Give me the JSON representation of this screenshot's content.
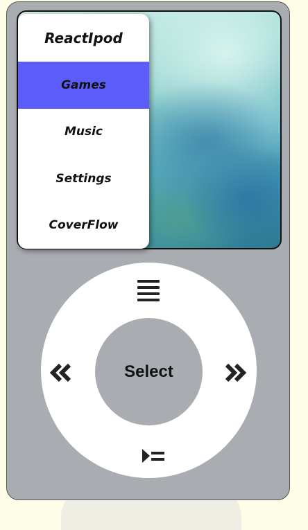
{
  "menu": {
    "title": "ReactIpod",
    "items": [
      {
        "label": "Games",
        "active": true
      },
      {
        "label": "Music",
        "active": false
      },
      {
        "label": "Settings",
        "active": false
      },
      {
        "label": "CoverFlow",
        "active": false
      }
    ]
  },
  "wheel": {
    "select_label": "Select",
    "icons": {
      "top": "menu-icon",
      "left": "rewind-icon",
      "right": "fast-forward-icon",
      "bottom": "play-pause-icon"
    }
  },
  "colors": {
    "body": "#a9acb0",
    "active_item": "#5c5cf8",
    "wheel": "#ffffff",
    "page_background": "#fdfde8"
  }
}
